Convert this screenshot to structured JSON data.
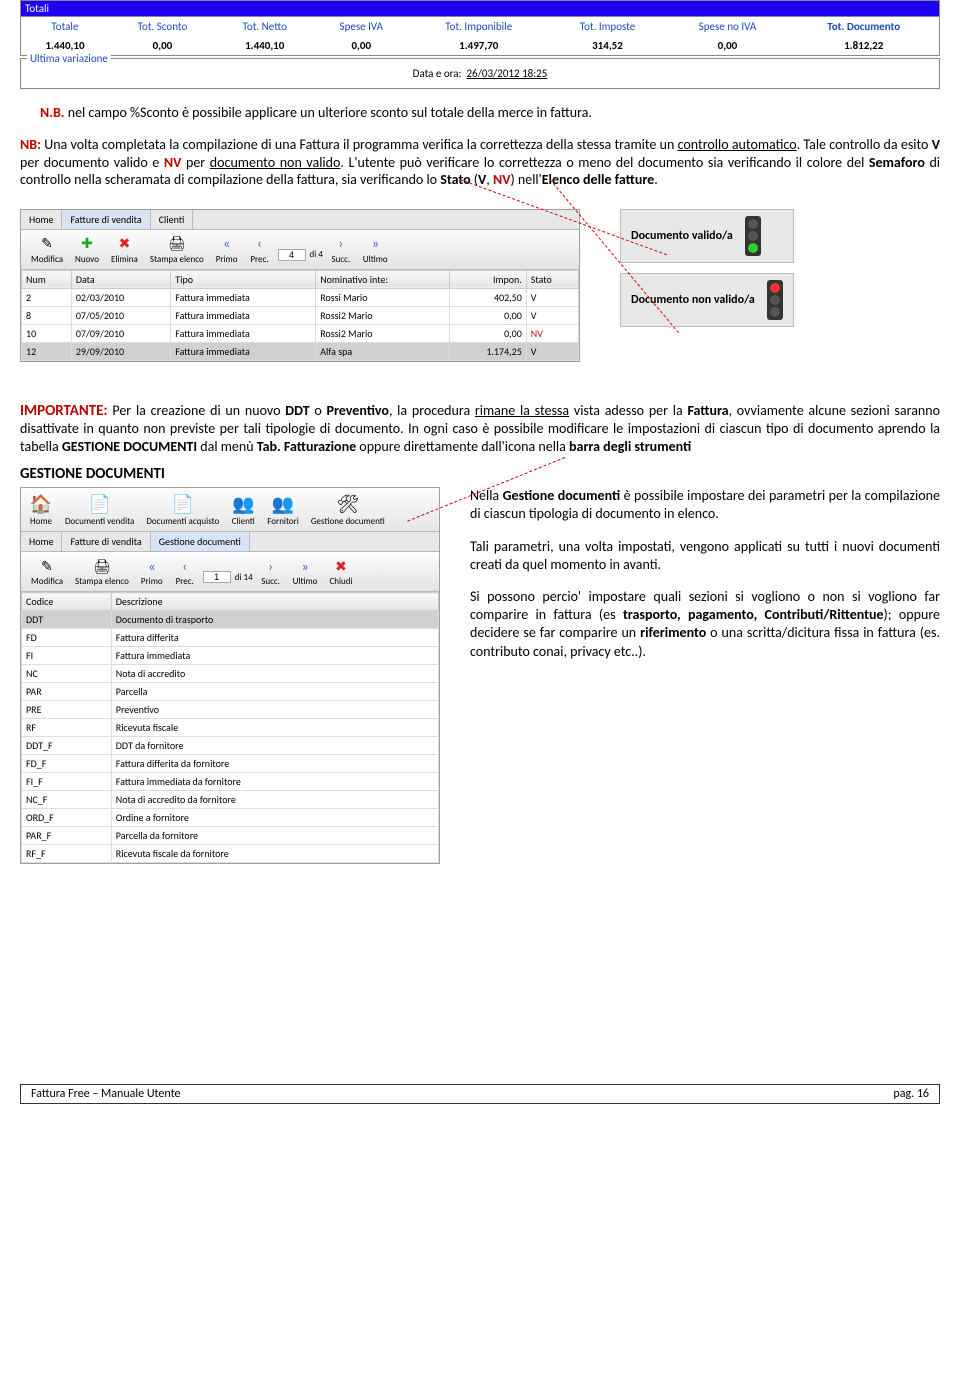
{
  "totals": {
    "title": "Totali",
    "cols": [
      "Totale",
      "Tot. Sconto",
      "Tot. Netto",
      "Spese IVA",
      "Tot. Imponibile",
      "Tot. Imposte",
      "Spese no IVA",
      "Tot. Documento"
    ],
    "vals": [
      "1.440,10",
      "0,00",
      "1.440,10",
      "0,00",
      "1.497,70",
      "314,52",
      "0,00",
      "1.812,22"
    ]
  },
  "ultima": {
    "label": "Ultima variazione",
    "dataora_label": "Data e ora:",
    "dataora_value": "26/03/2012 18:25"
  },
  "nb1": {
    "prefix": "N.B. ",
    "rest": "nel campo %Sconto è possibile applicare un ulteriore sconto sul totale della merce in fattura."
  },
  "para1": {
    "t1": "NB:",
    "t2": " Una volta completata la compilazione di una Fattura il programma verifica la correttezza della stessa tramite un ",
    "t3": "controllo automatico",
    "t4": ". Tale controllo da esito ",
    "t5": "V",
    "t6": " per documento valido e ",
    "t7": "NV",
    "t8": " per ",
    "t9": "documento non valido",
    "t10": ". L'utente può verificare lo correttezza o meno del documento sia verificando il colore del ",
    "t11": "Semaforo",
    "t12": " di controllo nella scheramata di compilazione della fattura, sia verificando lo ",
    "t13": "Stato",
    "t14": " (",
    "t15": "V",
    "t16": ", ",
    "t17": "NV",
    "t18": ") nell'",
    "t19": "Elenco delle fatture",
    "t20": "."
  },
  "app1": {
    "tabs": [
      "Home",
      "Fatture di vendita",
      "Clienti"
    ],
    "toolbar": {
      "modifica": "Modifica",
      "nuovo": "Nuovo",
      "elimina": "Elimina",
      "stampa": "Stampa elenco",
      "primo": "Primo",
      "prec": "Prec.",
      "pos": "4",
      "of": "di 4",
      "succ": "Succ.",
      "ultimo": "Ultimo"
    },
    "cols": [
      "Num",
      "Data",
      "Tipo",
      "Nominativo inte:",
      "Impon.",
      "Stato"
    ],
    "rows": [
      [
        "2",
        "02/03/2010",
        "Fattura immediata",
        "Rossi Mario",
        "402,50",
        "V"
      ],
      [
        "8",
        "07/05/2010",
        "Fattura immediata",
        "Rossi2 Mario",
        "0,00",
        "V"
      ],
      [
        "10",
        "07/09/2010",
        "Fattura immediata",
        "Rossi2 Mario",
        "0,00",
        "NV"
      ],
      [
        "12",
        "29/09/2010",
        "Fattura immediata",
        "Alfa spa",
        "1.174,25",
        "V"
      ]
    ]
  },
  "valido": {
    "ok": "Documento valido/a",
    "no": "Documento non valido/a"
  },
  "importante": {
    "head": "IMPORTANTE:",
    "body1": " Per la creazione di un nuovo ",
    "ddt": "DDT",
    "body2": " o ",
    "prev": "Preventivo",
    "body3": ", la procedura ",
    "rimane": "rimane la stessa",
    "body4": " vista adesso per la ",
    "fatt": "Fattura",
    "body5": ", ovviamente alcune sezioni saranno disattivate in quanto non previste per tali tipologie di documento. In ogni caso è possibile modificare le impostazioni di ciascun tipo di documento aprendo la tabella ",
    "gest": "GESTIONE DOCUMENTI",
    "body6": " dal menù ",
    "tab": "Tab. Fatturazione",
    "body7": " oppure direttamente dall'icona nella ",
    "barra": "barra degli strumenti"
  },
  "gd_title": "GESTIONE DOCUMENTI",
  "app2": {
    "bigtoolbar": [
      "Home",
      "Documenti vendita",
      "Documenti acquisto",
      "Clienti",
      "Fornitori",
      "Gestione documenti"
    ],
    "tabs2": [
      "Home",
      "Fatture di vendita",
      "Gestione documenti"
    ],
    "toolbar": {
      "modifica": "Modifica",
      "stampa": "Stampa elenco",
      "primo": "Primo",
      "prec": "Prec.",
      "pos": "1",
      "of": "di 14",
      "succ": "Succ.",
      "ultimo": "Ultimo",
      "chiudi": "Chiudi"
    },
    "cols": [
      "Codice",
      "Descrizione"
    ],
    "rows": [
      [
        "DDT",
        "Documento di trasporto"
      ],
      [
        "FD",
        "Fattura differita"
      ],
      [
        "FI",
        "Fattura immediata"
      ],
      [
        "NC",
        "Nota di accredito"
      ],
      [
        "PAR",
        "Parcella"
      ],
      [
        "PRE",
        "Preventivo"
      ],
      [
        "RF",
        "Ricevuta fiscale"
      ],
      [
        "DDT_F",
        "DDT da fornitore"
      ],
      [
        "FD_F",
        "Fattura differita da fornitore"
      ],
      [
        "FI_F",
        "Fattura immediata da fornitore"
      ],
      [
        "NC_F",
        "Nota di accredito da fornitore"
      ],
      [
        "ORD_F",
        "Ordine a fornitore"
      ],
      [
        "PAR_F",
        "Parcella da fornitore"
      ],
      [
        "RF_F",
        "Ricevuta fiscale da fornitore"
      ]
    ]
  },
  "gd_text": {
    "p1a": "Nella ",
    "p1b": "Gestione documenti",
    "p1c": " è possibile impostare dei parametri per la compilazione di ciascun tipologia di documento in elenco.",
    "p2": "Tali parametri, una volta impostati, vengono applicati su tutti i nuovi documenti creati da quel momento in avanti.",
    "p3a": "Si possono percio' impostare quali sezioni si vogliono o non si vogliono far comparire in fattura (es ",
    "p3b": "trasporto, pagamento, Contributi/Rittentue",
    "p3c": "); oppure decidere se far comparire un ",
    "p3d": "riferimento",
    "p3e": " o una scritta/dicitura fissa in fattura (es. contributo conai, privacy etc..)."
  },
  "footer": {
    "left": "Fattura Free – Manuale Utente",
    "right": "pag. 16"
  }
}
